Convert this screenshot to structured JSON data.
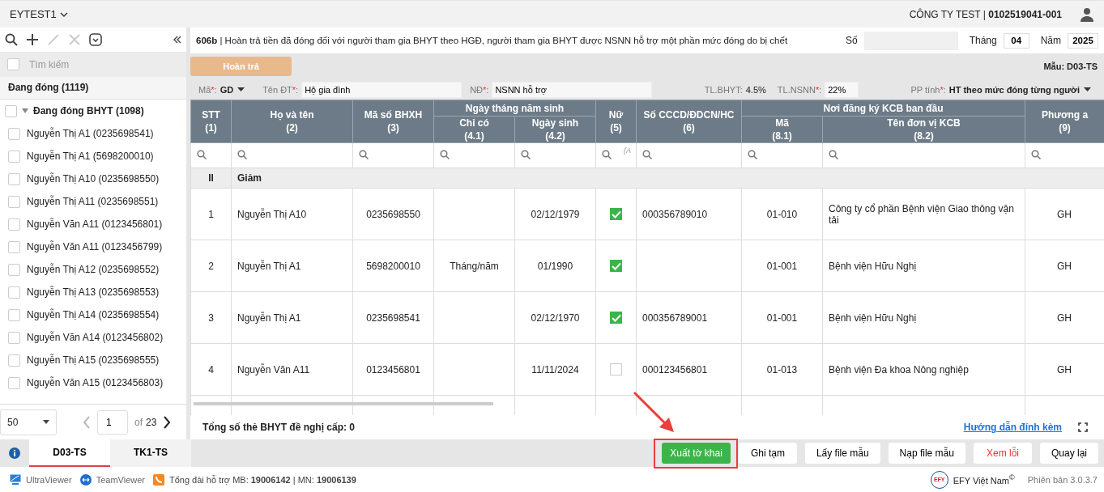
{
  "top_bar": {
    "workspace": "EYTEST1",
    "company": "CÔNG TY TEST | **0102519041-001**"
  },
  "sidebar": {
    "select_all_checked": false,
    "search_placeholder": "Tìm kiếm",
    "group": "Đang đóng (1119)",
    "tree": [
      {
        "label": "Đang đóng BHYT (1098)",
        "expanded": true,
        "checked": false,
        "children": [
          {
            "label": "Nguyễn Thị A1 (0235698541)",
            "checked": false
          },
          {
            "label": "Nguyễn Thị A1 (5698200010)",
            "checked": false
          },
          {
            "label": "Nguyễn Thị A10 (0235698550)",
            "checked": false
          },
          {
            "label": "Nguyễn Thị A11 (0235698551)",
            "checked": false
          },
          {
            "label": "Nguyễn Văn A11 (0123456801)",
            "checked": false
          },
          {
            "label": "Nguyễn Văn A11 (0123456799)",
            "checked": false
          },
          {
            "label": "Nguyễn Thị A12 (0235698552)",
            "checked": false
          },
          {
            "label": "Nguyễn Thị A13 (0235698553)",
            "checked": false
          },
          {
            "label": "Nguyễn Thị A14 (0235698554)",
            "checked": false
          },
          {
            "label": "Nguyễn Văn A14 (0123456802)",
            "checked": false
          },
          {
            "label": "Nguyễn Thị A15 (0235698555)",
            "checked": false
          },
          {
            "label": "Nguyễn Văn A15 (0123456803)",
            "checked": false
          }
        ]
      }
    ],
    "pagination": {
      "page_size": "50",
      "page": "1",
      "of": "of",
      "total": "23"
    }
  },
  "form": {
    "title": "**606b** | Hoàn trả tiền đã đóng đối với người tham gia BHYT theo HGĐ, người tham gia BHYT được NSNN hỗ trợ một phần mức đóng do bị chết",
    "number_label": "Số",
    "month_label": "Tháng",
    "month": "04",
    "year_label": "Năm",
    "year": "2025",
    "action_button": "Hoàn trả",
    "template": "Mẫu: D03-TS",
    "fields": [
      {
        "kind": "select",
        "label": "Mã",
        "mark": "*",
        "colon": ":",
        "value": "GD"
      },
      {
        "kind": "input",
        "label": "Tên ĐT",
        "mark": "*",
        "colon": ":",
        "value": "Hộ gia đình"
      },
      {
        "kind": "input",
        "label": "NĐ",
        "mark": "*",
        "colon": ":",
        "value": "NSNN hỗ trợ"
      },
      {
        "kind": "text",
        "label": "TL.BHYT",
        "colon": ":",
        "value": "4.5%"
      },
      {
        "kind": "input",
        "label": "TL.NSNN",
        "mark": "*",
        "colon": ":",
        "value": "22%"
      },
      {
        "kind": "select",
        "label": "PP tính",
        "mark": "*",
        "colon": ":",
        "value": "HT theo mức đóng từng người"
      }
    ]
  },
  "table": {
    "columns": [
      {
        "title": "STT",
        "number": "(1)"
      },
      {
        "title": "Họ và tên",
        "number": "(2)"
      },
      {
        "title": "Mã số BHXH",
        "number": "(3)"
      },
      {
        "title": "Ngày tháng năm sinh",
        "children": [
          {
            "title": "Chỉ có",
            "number": "(4.1)"
          },
          {
            "title": "Ngày sinh",
            "number": "(4.2)"
          }
        ]
      },
      {
        "title": "Nữ",
        "number": "(5)"
      },
      {
        "title": "Số CCCD/ĐDCN/HC",
        "number": "(6)"
      },
      {
        "title": "Nơi đăng ký KCB ban đầu",
        "children": [
          {
            "title": "Mã",
            "number": "(8.1)"
          },
          {
            "title": "Tên đơn vị KCB",
            "number": "(8.2)"
          }
        ]
      },
      {
        "title": "Phương a",
        "number": "(9)"
      }
    ],
    "female_filter": "(A",
    "rows": [
      {
        "kind": "group",
        "stt": "II",
        "name": "Giảm"
      },
      {
        "kind": "data",
        "stt": "1",
        "name": "Nguyễn Thị A10",
        "bhxh": "0235698550",
        "dob": "02/12/1979",
        "female": true,
        "cccd": "000356789010",
        "kcb_code": "01-010",
        "kcb_name": "Công ty cổ phần Bệnh viện Giao thông vận tải",
        "option": "GH"
      },
      {
        "kind": "data",
        "stt": "2",
        "name": "Nguyễn Thị A1",
        "bhxh": "5698200010",
        "dob_type": "Tháng/năm",
        "dob": "01/1990",
        "female": true,
        "kcb_code": "01-001",
        "kcb_name": "Bệnh viện Hữu Nghị",
        "option": "GH"
      },
      {
        "kind": "data",
        "stt": "3",
        "name": "Nguyễn Thị A1",
        "bhxh": "0235698541",
        "dob": "02/12/1970",
        "female": true,
        "cccd": "000356789001",
        "kcb_code": "01-001",
        "kcb_name": "Bệnh viện Hữu Nghị",
        "option": "GH"
      },
      {
        "kind": "data",
        "stt": "4",
        "name": "Nguyễn Văn A11",
        "bhxh": "0123456801",
        "dob": "11/11/2024",
        "female": false,
        "cccd": "000123456801",
        "kcb_code": "01-013",
        "kcb_name": "Bệnh viện Đa khoa Nông nghiệp",
        "option": "GH"
      }
    ],
    "total": "Tổng số thẻ BHYT đề nghị cấp: 0",
    "guide_link": "Hướng dẫn đính kèm"
  },
  "bottom_tabs": [
    {
      "label": "D03-TS",
      "selected": true
    },
    {
      "label": "TK1-TS",
      "selected": false
    }
  ],
  "buttons": [
    {
      "kind": "primary",
      "label": "Xuất tờ khai"
    },
    {
      "kind": "default",
      "label": "Ghi tạm"
    },
    {
      "kind": "default",
      "label": "Lấy file mẫu"
    },
    {
      "kind": "default",
      "label": "Nạp file mẫu"
    },
    {
      "kind": "danger",
      "label": "Xem lỗi"
    },
    {
      "kind": "default",
      "label": "Quay lại"
    }
  ],
  "status_bar": {
    "remote_tools": [
      "UltraViewer",
      "TeamViewer"
    ],
    "hotline": "Tổng đài hỗ trợ MB: **19006142** | MN: **19006139**",
    "logo_text": "EFY",
    "brand": "EFY Việt Nam$^{©}$",
    "version": "Phiên bản 3.0.3.7"
  }
}
